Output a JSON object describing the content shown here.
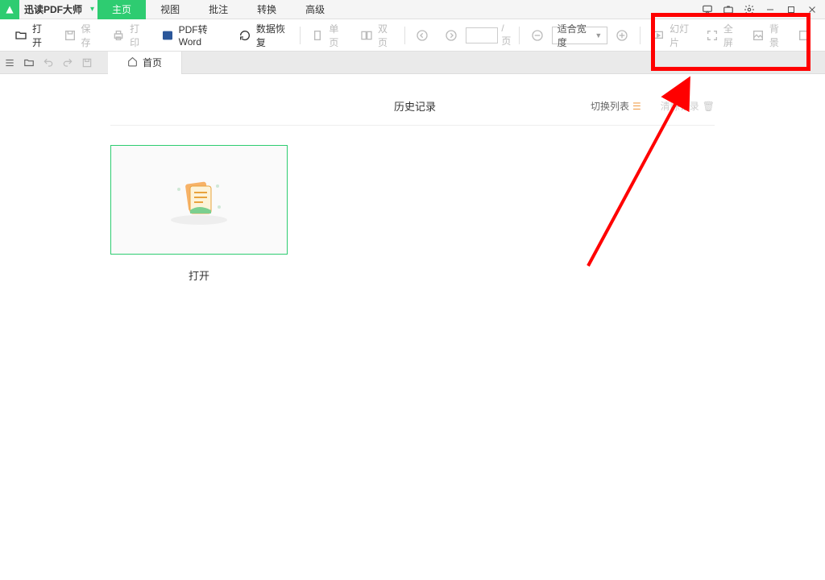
{
  "app": {
    "name": "迅读PDF大师"
  },
  "menu": {
    "home": "主页",
    "view": "视图",
    "annotate": "批注",
    "convert": "转换",
    "advanced": "高级"
  },
  "toolbar": {
    "open": "打开",
    "save": "保存",
    "print": "打印",
    "pdf2word": "PDF转Word",
    "recover": "数据恢复",
    "single": "单页",
    "double": "双页",
    "page_unit": "/页",
    "zoom_mode": "适合宽度",
    "slide": "幻灯片",
    "fullscreen": "全屏",
    "background": "背景"
  },
  "tabs": {
    "home": "首页"
  },
  "history": {
    "title": "历史记录",
    "switch": "切换列表",
    "clear": "清除记录"
  },
  "card": {
    "open": "打开"
  }
}
